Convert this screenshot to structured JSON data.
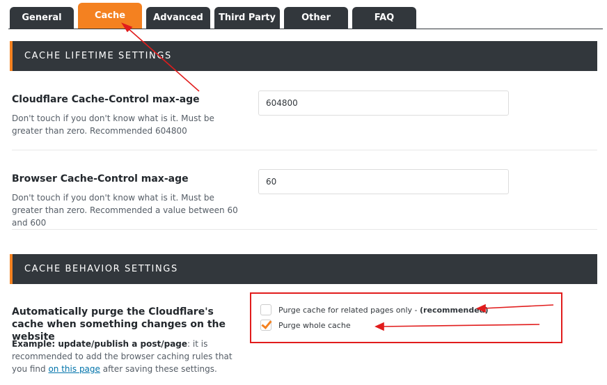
{
  "tabs": [
    {
      "label": "General"
    },
    {
      "label": "Cache",
      "active": true
    },
    {
      "label": "Advanced"
    },
    {
      "label": "Third Party"
    },
    {
      "label": "Other"
    },
    {
      "label": "FAQ"
    }
  ],
  "lifetime_section": {
    "title": "CACHE LIFETIME SETTINGS",
    "cloudflare_max_age": {
      "label": "Cloudflare Cache-Control max-age",
      "description": "Don't touch if you don't know what is it. Must be greater than zero. Recommended 604800",
      "value": "604800"
    },
    "browser_max_age": {
      "label": "Browser Cache-Control max-age",
      "description": "Don't touch if you don't know what is it. Must be greater than zero. Recommended a value between 60 and 600",
      "value": "60"
    }
  },
  "behavior_section": {
    "title": "CACHE BEHAVIOR SETTINGS",
    "auto_purge": {
      "label": "Automatically purge the Cloudflare's cache when something changes on the website",
      "example_bold": "Example: update/publish a post/page",
      "example_text_1": ": it is recommended to add the browser caching rules that you find ",
      "example_link": "on this page",
      "example_text_2": " after saving these settings.",
      "options": [
        {
          "label": "Purge cache for related pages only - ",
          "label_bold": "(recommended)",
          "checked": false
        },
        {
          "label": "Purge whole cache",
          "checked": true
        }
      ]
    }
  },
  "colors": {
    "accent": "#f48120",
    "dark": "#32373c",
    "annotation": "#e11c1c"
  }
}
